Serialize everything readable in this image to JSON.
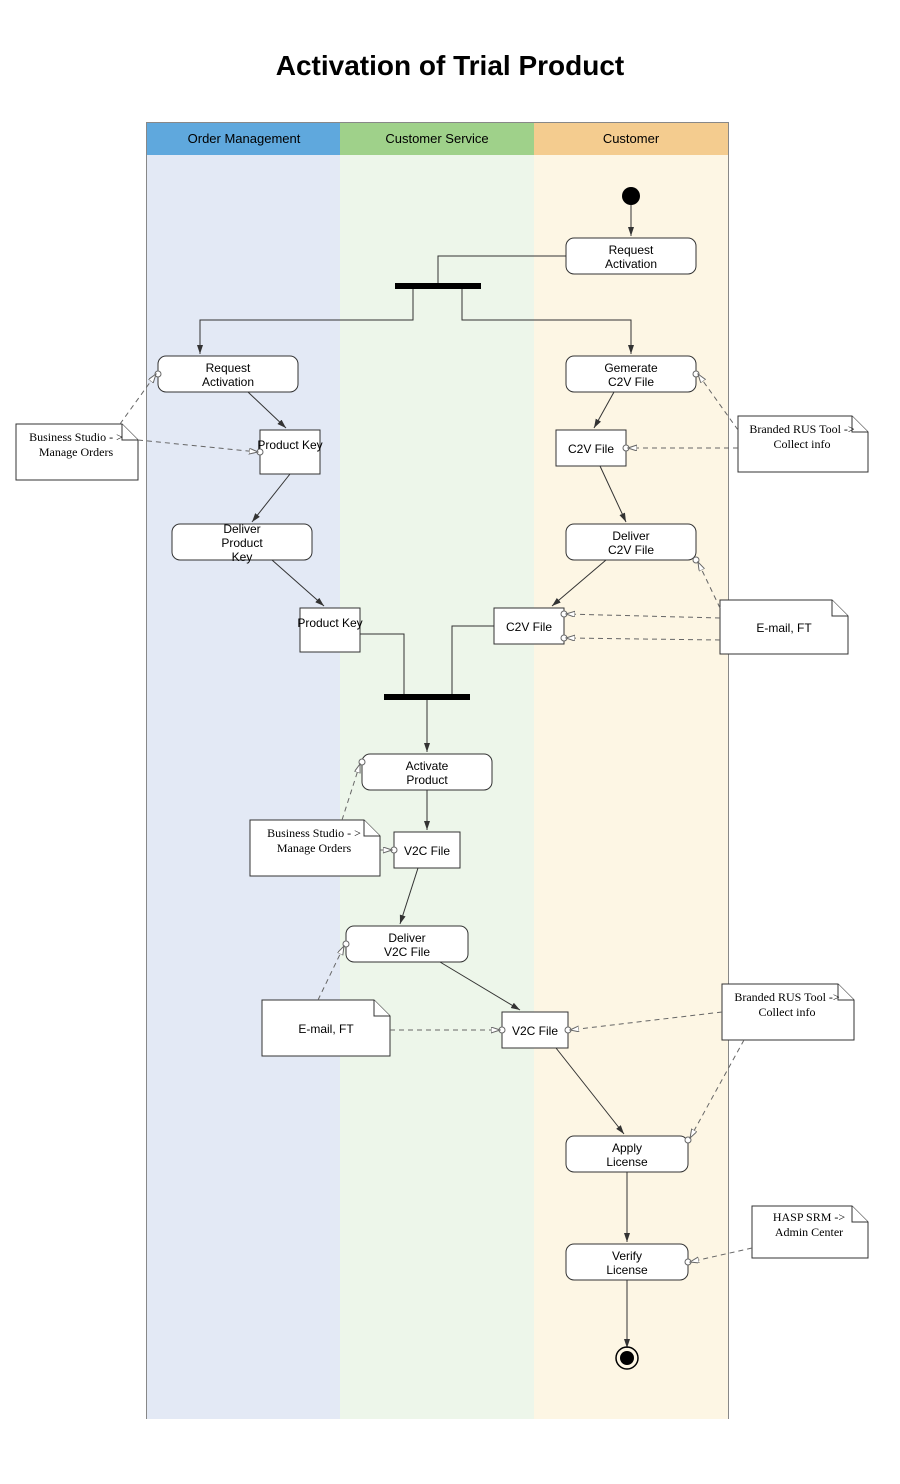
{
  "title": "Activation of Trial Product",
  "lanes": {
    "l1": "Order Management",
    "l2": "Customer Service",
    "l3": "Customer"
  },
  "a": {
    "reqAct3": "Request Activation",
    "reqAct1": "Request Activation",
    "prodKey1": "Product Key",
    "delProdKey": "Deliver Product Key",
    "prodKey2": "Product Key",
    "genC2V": "Gemerate C2V File",
    "c2v1": "C2V File",
    "delC2V": "Deliver C2V File",
    "c2v2": "C2V File",
    "actProd": "Activate Product",
    "v2c1": "V2C File",
    "delV2C": "Deliver V2C File",
    "v2c2": "V2C File",
    "applyLic": "Apply License",
    "verifyLic": "Verify License"
  },
  "n": {
    "bs1": "Business Studio - > Manage Orders",
    "bs2": "Business Studio - > Manage Orders",
    "rus1": "Branded RUS Tool -> Collect info",
    "rus2": "Branded RUS Tool -> Collect info",
    "email1": "E-mail, FT",
    "email2": "E-mail, FT",
    "hasp": "HASP SRM -> Admin Center"
  }
}
